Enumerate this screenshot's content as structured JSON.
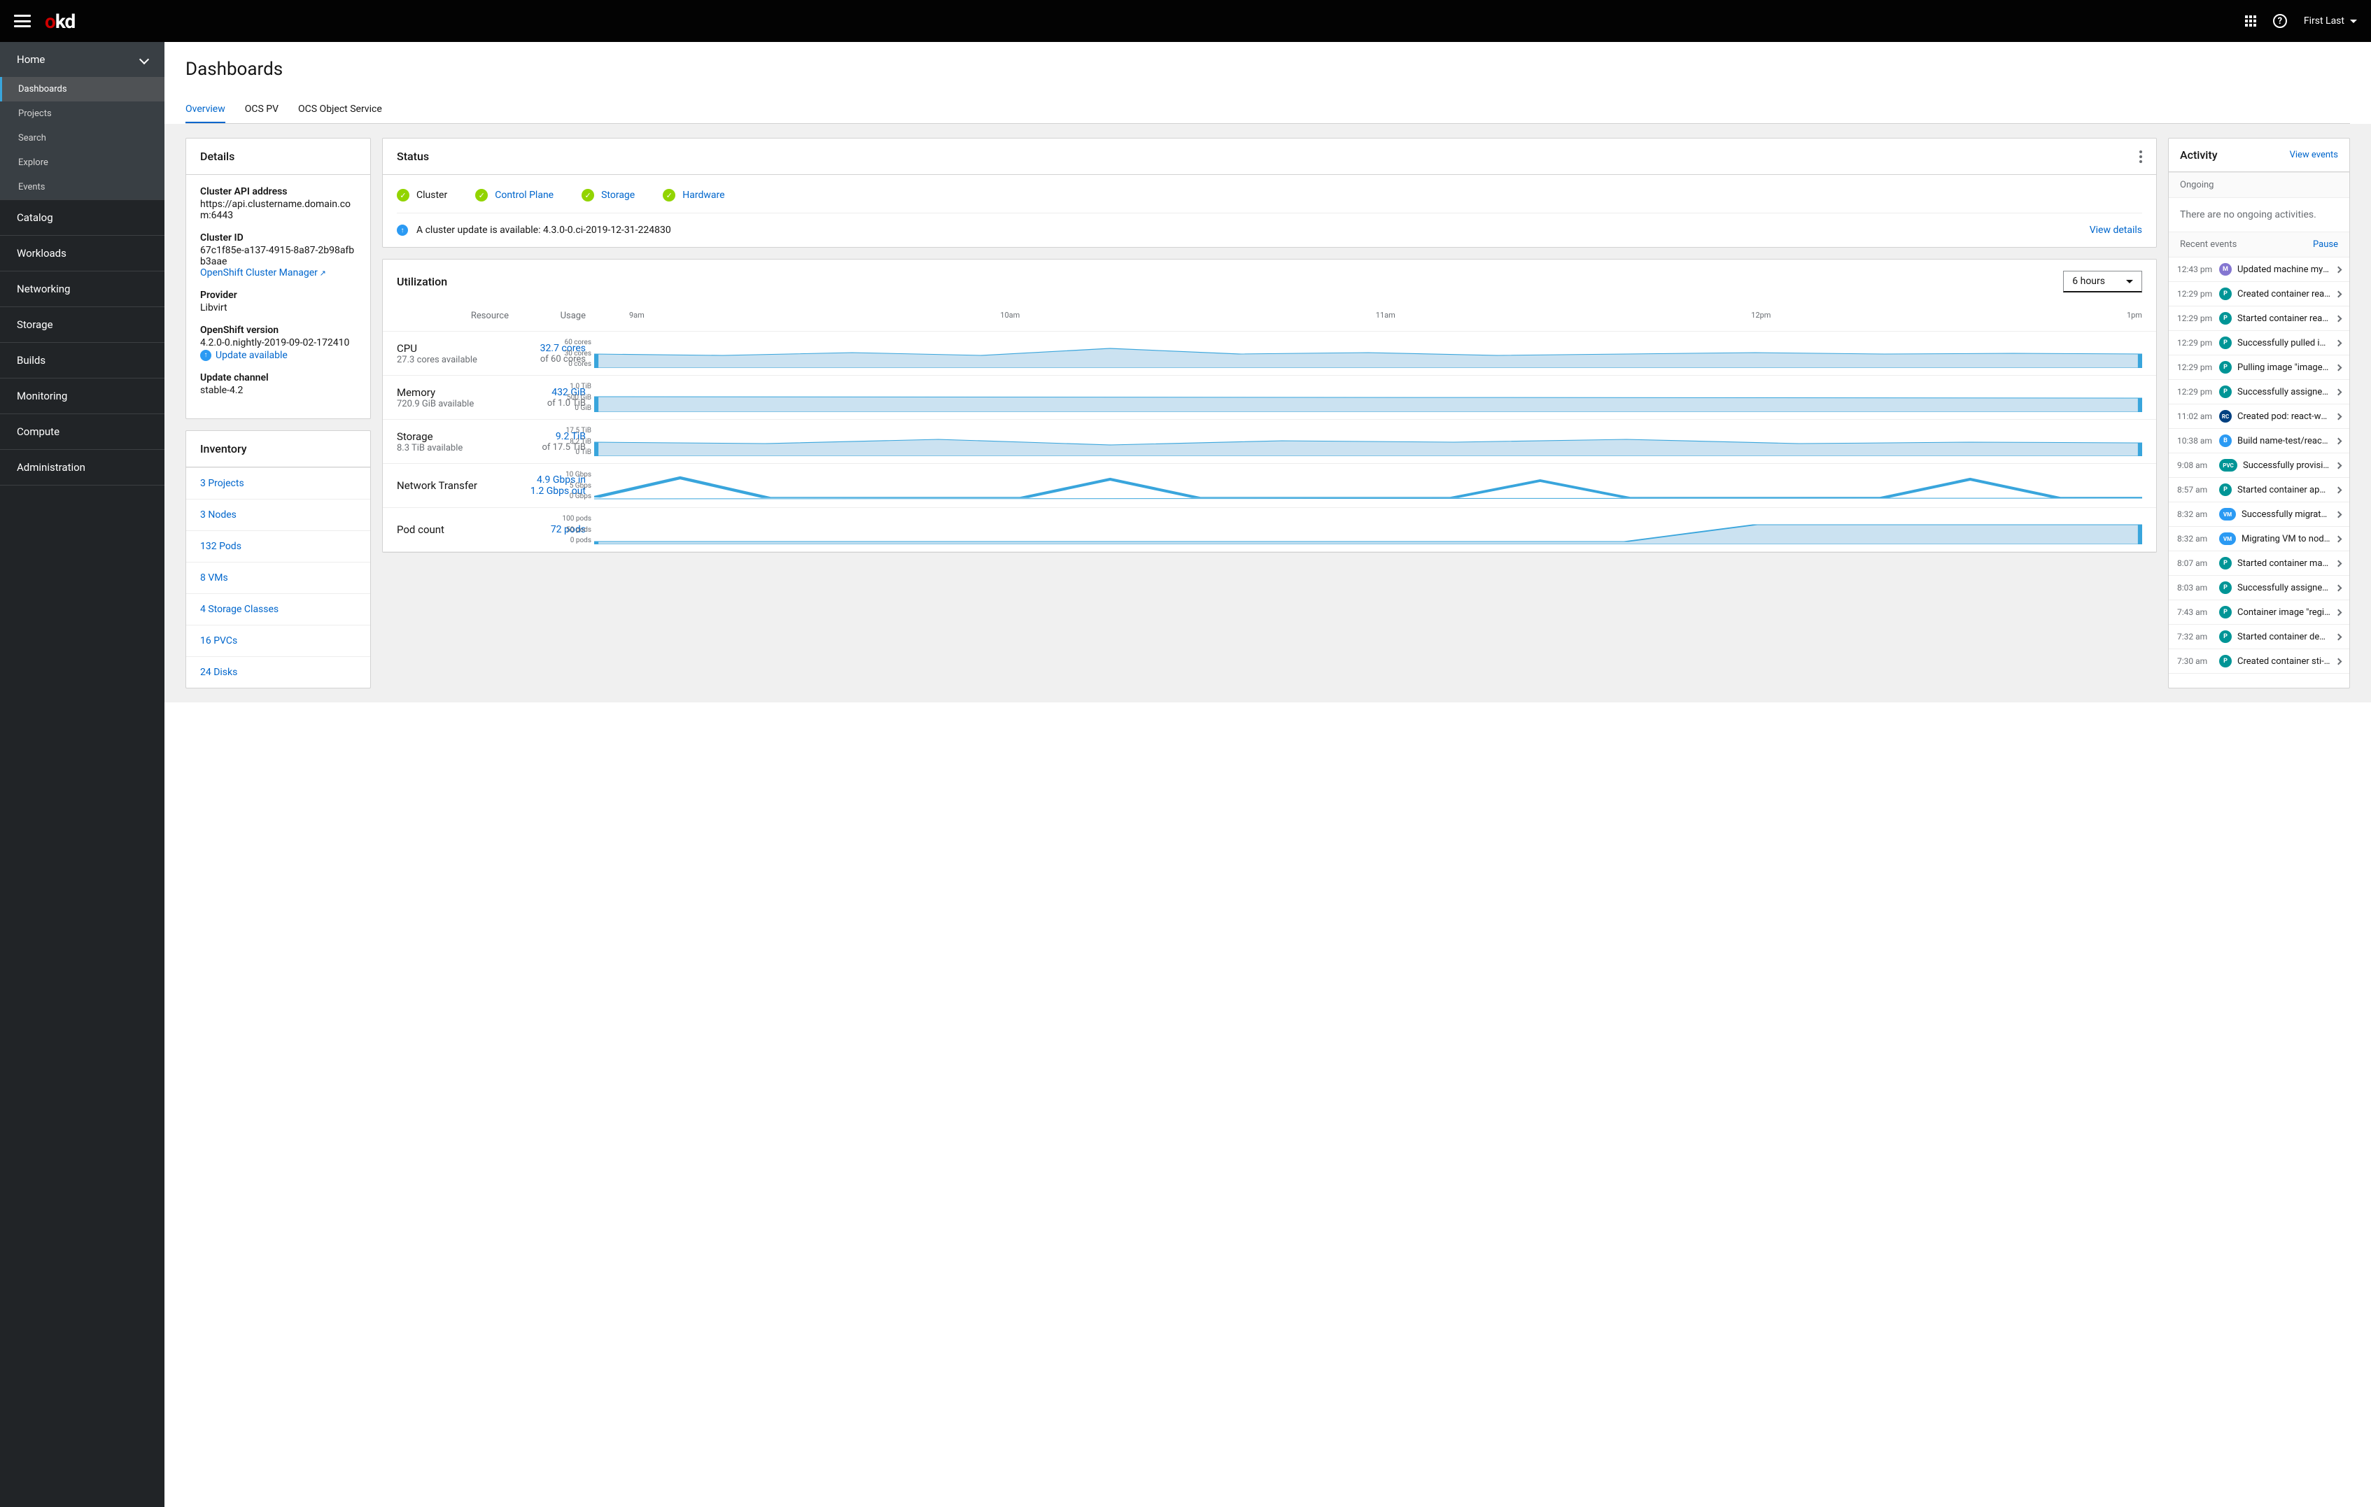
{
  "header": {
    "brand_o": "o",
    "brand_kd": "kd",
    "user": "First Last",
    "help": "?"
  },
  "sidebar": {
    "sections": [
      {
        "label": "Home",
        "expanded": true,
        "items": [
          "Dashboards",
          "Projects",
          "Search",
          "Explore",
          "Events"
        ],
        "active": 0
      },
      {
        "label": "Catalog"
      },
      {
        "label": "Workloads"
      },
      {
        "label": "Networking"
      },
      {
        "label": "Storage"
      },
      {
        "label": "Builds"
      },
      {
        "label": "Monitoring"
      },
      {
        "label": "Compute"
      },
      {
        "label": "Administration"
      }
    ]
  },
  "page": {
    "title": "Dashboards",
    "tabs": [
      "Overview",
      "OCS PV",
      "OCS Object Service"
    ],
    "active_tab": 0
  },
  "details": {
    "title": "Details",
    "items": {
      "api_label": "Cluster API address",
      "api_value": "https://api.clustername.domain.com:6443",
      "id_label": "Cluster ID",
      "id_value": "67c1f85e-a137-4915-8a87-2b98afbb3aae",
      "manager_link": "OpenShift Cluster Manager",
      "provider_label": "Provider",
      "provider_value": "Libvirt",
      "version_label": "OpenShift version",
      "version_value": "4.2.0-0.nightly-2019-09-02-172410",
      "update_link": "Update available",
      "channel_label": "Update channel",
      "channel_value": "stable-4.2"
    }
  },
  "status": {
    "title": "Status",
    "items": [
      {
        "label": "Cluster",
        "link": false
      },
      {
        "label": "Control Plane",
        "link": true
      },
      {
        "label": "Storage",
        "link": true
      },
      {
        "label": "Hardware",
        "link": true
      }
    ],
    "alert_text": "A cluster update is available: 4.3.0-0.ci-2019-12-31-224830",
    "alert_link": "View details"
  },
  "inventory": {
    "title": "Inventory",
    "items": [
      "3 Projects",
      "3 Nodes",
      "132 Pods",
      "8 VMs",
      "4 Storage Classes",
      "16 PVCs",
      "24 Disks"
    ]
  },
  "utilization": {
    "title": "Utilization",
    "dropdown": "6 hours",
    "head_resource": "Resource",
    "head_usage": "Usage",
    "time_labels": [
      "9am",
      "10am",
      "11am",
      "12pm",
      "1pm"
    ],
    "rows": [
      {
        "name": "CPU",
        "sub": "27.3 cores available",
        "usage": "32.7 cores",
        "usage_sub": "of 60 cores",
        "ticks": [
          "60 cores",
          "30 cores",
          "0 cores"
        ]
      },
      {
        "name": "Memory",
        "sub": "720.9 GiB available",
        "usage": "432 GiB",
        "usage_sub": "of 1.0 TiB",
        "ticks": [
          "1.0 TiB",
          "500 GiB",
          "0 GiB"
        ]
      },
      {
        "name": "Storage",
        "sub": "8.3 TiB available",
        "usage": "9.2 TiB",
        "usage_sub": "of 17.5 TiB",
        "ticks": [
          "17.5 TiB",
          "8.2 TiB",
          "0 TiB"
        ]
      },
      {
        "name": "Network Transfer",
        "sub": "",
        "usage": "4.9 Gbps in",
        "usage_sub": "1.2 Gbps out",
        "usage_sub_link": true,
        "ticks": [
          "10 Gbps",
          "5 Gbps",
          "0 Gbps"
        ]
      },
      {
        "name": "Pod count",
        "sub": "",
        "usage": "72 pods",
        "usage_sub": "",
        "ticks": [
          "100 pods",
          "50 pods",
          "0 pods"
        ]
      }
    ]
  },
  "activity": {
    "title": "Activity",
    "view_events": "View events",
    "ongoing_label": "Ongoing",
    "ongoing_empty": "There are no ongoing activities.",
    "recent_label": "Recent events",
    "pause": "Pause",
    "events": [
      {
        "time": "12:43 pm",
        "badge": "M",
        "bcls": "badge-M",
        "text": "Updated machine mynam..."
      },
      {
        "time": "12:29 pm",
        "badge": "P",
        "bcls": "badge-P",
        "text": "Created container reacta..."
      },
      {
        "time": "12:29 pm",
        "badge": "P",
        "bcls": "badge-P",
        "text": "Started container reacta..."
      },
      {
        "time": "12:29 pm",
        "badge": "P",
        "bcls": "badge-P",
        "text": "Successfully pulled imag..."
      },
      {
        "time": "12:29 pm",
        "badge": "P",
        "bcls": "badge-P",
        "text": "Pulling image \"image-re..."
      },
      {
        "time": "12:29 pm",
        "badge": "P",
        "bcls": "badge-P",
        "text": "Successfully assigned ap..."
      },
      {
        "time": "11:02 am",
        "badge": "RC",
        "bcls": "badge-RC",
        "text": "Created pod: react-web..."
      },
      {
        "time": "10:38 am",
        "badge": "B",
        "bcls": "badge-B",
        "text": "Build name-test/react-we..."
      },
      {
        "time": "9:08 am",
        "badge": "PVC",
        "bcls": "badge-PVC",
        "text": "Successfully provision..."
      },
      {
        "time": "8:57 am",
        "badge": "P",
        "bcls": "badge-P",
        "text": "Started container appde..."
      },
      {
        "time": "8:32 am",
        "badge": "VM",
        "bcls": "badge-VM",
        "text": "Successfully migrated V..."
      },
      {
        "time": "8:32 am",
        "badge": "VM",
        "bcls": "badge-VM",
        "text": "Migrating VM to node ip..."
      },
      {
        "time": "8:07 am",
        "badge": "P",
        "bcls": "badge-P",
        "text": "Started container manag..."
      },
      {
        "time": "8:03 am",
        "badge": "P",
        "bcls": "badge-P",
        "text": "Successfully assigned m..."
      },
      {
        "time": "7:43 am",
        "badge": "P",
        "bcls": "badge-P",
        "text": "Container image \"registr..."
      },
      {
        "time": "7:32 am",
        "badge": "P",
        "bcls": "badge-P",
        "text": "Started container deploy..."
      },
      {
        "time": "7:30 am",
        "badge": "P",
        "bcls": "badge-P",
        "text": "Created container sti-bu..."
      }
    ]
  }
}
